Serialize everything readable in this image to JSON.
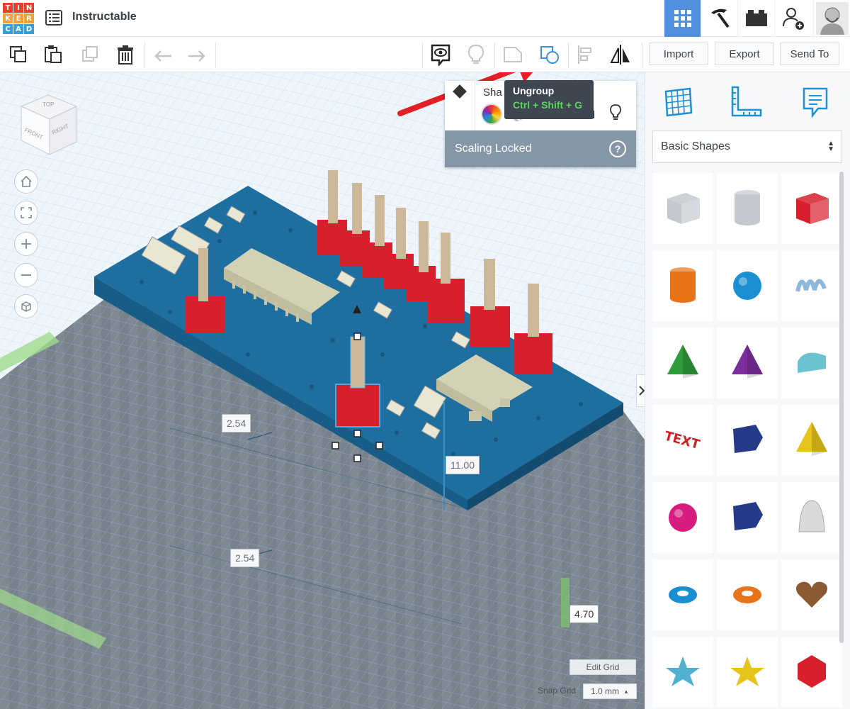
{
  "app": {
    "logo_letters": [
      "T",
      "I",
      "N",
      "K",
      "E",
      "R",
      "C",
      "A",
      "D"
    ],
    "logo_colors": [
      "#e2422c",
      "#e2422c",
      "#e2422c",
      "#f0a233",
      "#f0a233",
      "#f0a233",
      "#36a1d6",
      "#36a1d6",
      "#36a1d6"
    ],
    "title": "Instructable"
  },
  "header": {
    "buttons": [
      {
        "name": "3d-design-view-button",
        "icon": "grid-icon",
        "active": true
      },
      {
        "name": "codeblocks-button",
        "icon": "pickaxe-icon",
        "active": false
      },
      {
        "name": "lego-bricks-button",
        "icon": "brick-icon",
        "active": false
      },
      {
        "name": "invite-user-button",
        "icon": "add-user-icon",
        "active": false
      },
      {
        "name": "user-avatar",
        "icon": "avatar-icon",
        "active": false
      }
    ]
  },
  "toolbar": {
    "import_label": "Import",
    "export_label": "Export",
    "send_to_label": "Send To",
    "icons": [
      "copy-icon",
      "paste-icon",
      "duplicate-icon",
      "delete-icon",
      "undo-icon",
      "redo-icon",
      "notes-icon",
      "light-icon",
      "group-icon",
      "ungroup-icon",
      "align-icon",
      "mirror-icon"
    ]
  },
  "tooltip": {
    "title": "Ungroup",
    "shortcut": "Ctrl + Shift + G"
  },
  "inspector": {
    "header_label": "Sha",
    "scaling_locked_label": "Scaling Locked",
    "help_label": "?"
  },
  "viewcube": {
    "top": "TOP",
    "front": "FRONT",
    "right": "RIGHT"
  },
  "dimensions": {
    "width_top": "2.54",
    "width_bottom": "2.54",
    "height": "11.00",
    "elevation": "4.70"
  },
  "workplane": {
    "edit_grid_label": "Edit Grid",
    "snap_grid_label": "Snap Grid",
    "snap_grid_value": "1.0 mm",
    "snap_caret": "▲"
  },
  "panel": {
    "category": "Basic Shapes",
    "shapes": [
      {
        "name": "box-hole",
        "color": "#c5c9cf"
      },
      {
        "name": "cylinder-hole",
        "color": "#c5c9cf"
      },
      {
        "name": "box",
        "color": "#d7202b"
      },
      {
        "name": "cylinder",
        "color": "#e8741a"
      },
      {
        "name": "sphere",
        "color": "#1a8fd1"
      },
      {
        "name": "scribble",
        "color": "#8fb8db"
      },
      {
        "name": "roof",
        "color": "#2e9c3a"
      },
      {
        "name": "cone",
        "color": "#7b2f9c"
      },
      {
        "name": "round-roof",
        "color": "#6bc3d1"
      },
      {
        "name": "text",
        "color": "#d32027"
      },
      {
        "name": "wedge",
        "color": "#243b8a"
      },
      {
        "name": "pyramid",
        "color": "#e7c41a"
      },
      {
        "name": "half-sphere",
        "color": "#d81b7e"
      },
      {
        "name": "polygon",
        "color": "#243b8a"
      },
      {
        "name": "paraboloid",
        "color": "#d9dadc"
      },
      {
        "name": "torus",
        "color": "#1a8fd1"
      },
      {
        "name": "tube",
        "color": "#e8741a"
      },
      {
        "name": "heart",
        "color": "#8a5a33"
      },
      {
        "name": "star",
        "color": "#4fb0d0"
      },
      {
        "name": "star-gold",
        "color": "#e7c41a"
      },
      {
        "name": "icosahedron",
        "color": "#d7202b"
      }
    ]
  },
  "colors": {
    "accent": "#4f8fdd",
    "board": "#1e6e9f",
    "header_red": "#d7202b",
    "arrow": "#e41e25"
  }
}
